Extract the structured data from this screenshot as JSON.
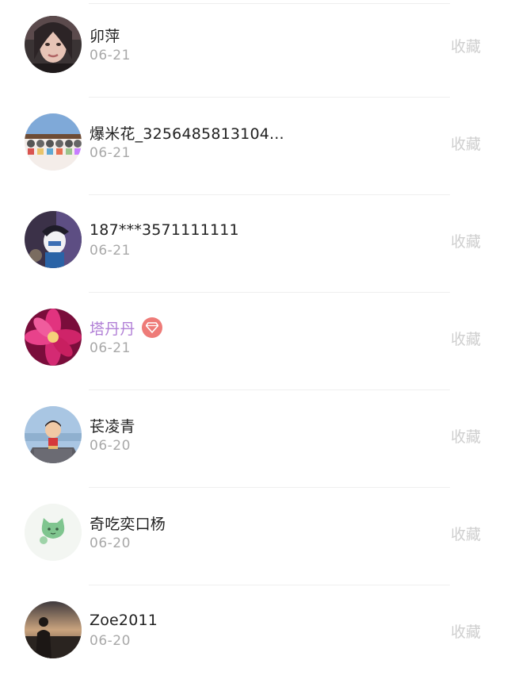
{
  "list": {
    "items": [
      {
        "name": "卯萍",
        "date": "06-21",
        "action": "收藏",
        "vip": false,
        "avatar_icon": "woman-portrait-avatar"
      },
      {
        "name": "爆米花_3256485813104...",
        "date": "06-21",
        "action": "收藏",
        "vip": false,
        "avatar_icon": "figurines-row-avatar"
      },
      {
        "name": "187***3571111111",
        "date": "06-21",
        "action": "收藏",
        "vip": false,
        "avatar_icon": "anime-character-avatar"
      },
      {
        "name": "塔丹丹",
        "date": "06-21",
        "action": "收藏",
        "vip": true,
        "vip_badge_icon": "diamond-icon",
        "avatar_icon": "pink-flower-avatar"
      },
      {
        "name": "苌凌青",
        "date": "06-20",
        "action": "收藏",
        "vip": false,
        "avatar_icon": "cartoon-boy-avatar"
      },
      {
        "name": "奇吃奕口杨",
        "date": "06-20",
        "action": "收藏",
        "vip": false,
        "avatar_icon": "green-cat-avatar"
      },
      {
        "name": "Zoe2011",
        "date": "06-20",
        "action": "收藏",
        "vip": false,
        "avatar_icon": "sunset-person-avatar"
      }
    ]
  },
  "colors": {
    "name_text": "#222222",
    "vip_name_text": "#b17fd6",
    "date_text": "#a8a8a8",
    "action_text": "#cfcfcf",
    "vip_badge": "#ee7b78"
  }
}
